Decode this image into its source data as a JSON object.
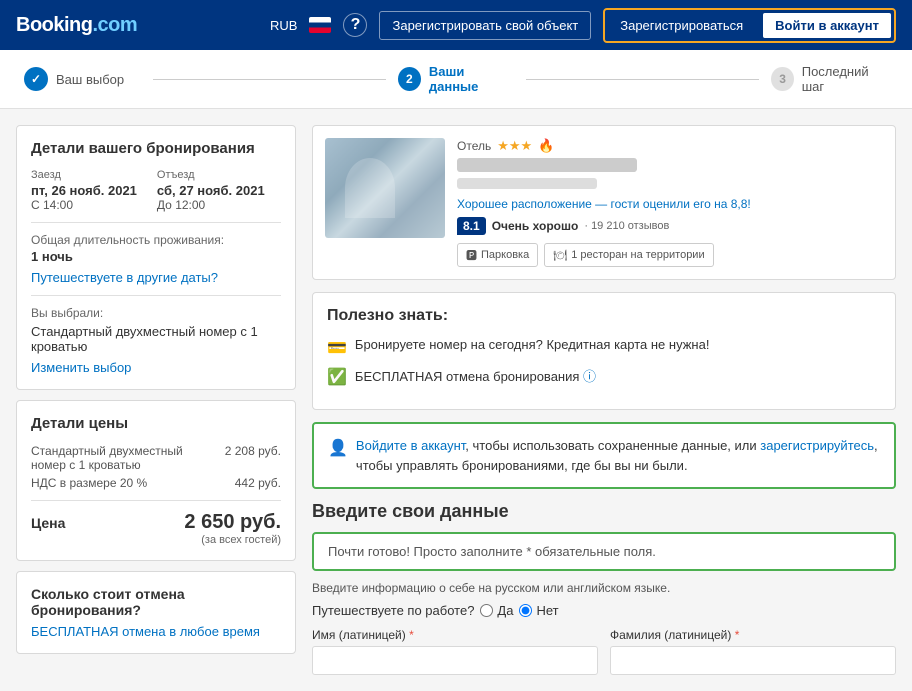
{
  "header": {
    "logo": "Booking.com",
    "logo_dot": ".com",
    "currency": "RUB",
    "help_label": "?",
    "register_property_label": "Зарегистрировать свой объект",
    "signin_label": "Зарегистрироваться",
    "login_label": "Войти в аккаунт"
  },
  "progress": {
    "step1": {
      "number": "✓",
      "label": "Ваш выбор",
      "state": "done"
    },
    "step2": {
      "number": "2",
      "label": "Ваши данные",
      "state": "active"
    },
    "step3": {
      "number": "3",
      "label": "Последний шаг",
      "state": "inactive"
    }
  },
  "booking_details": {
    "title": "Детали вашего бронирования",
    "checkin_label": "Заезд",
    "checkin_date": "пт, 26 нояб. 2021",
    "checkin_time": "С 14:00",
    "checkout_label": "Отъезд",
    "checkout_date": "сб, 27 нояб. 2021",
    "checkout_time": "До 12:00",
    "duration_label": "Общая длительность проживания:",
    "duration_value": "1 ночь",
    "change_dates_link": "Путешествуете в другие даты?",
    "room_section_label": "Вы выбрали:",
    "room_name": "Стандартный двухместный номер с 1 кроватью",
    "change_room_link": "Изменить выбор"
  },
  "price_details": {
    "title": "Детали цены",
    "room_price_label": "Стандартный двухместный номер с 1 кроватью",
    "room_price_value": "2 208 руб.",
    "vat_label": "НДС в размере 20 %",
    "vat_value": "442 руб.",
    "total_label": "Цена",
    "total_value": "2 650 руб.",
    "guests_note": "(за всех гостей)"
  },
  "cancellation": {
    "title": "Сколько стоит отмена бронирования?",
    "link": "БЕСПЛАТНАЯ отмена в любое время"
  },
  "hotel": {
    "type": "Отель",
    "stars": "★★★",
    "location_good": "Хорошее расположение — гости оценили его на 8,8!",
    "rating_value": "8.1",
    "rating_label": "Очень хорошо",
    "review_count": "19 210 отзывов",
    "amenities": [
      {
        "icon": "P",
        "label": "Парковка"
      },
      {
        "icon": "🍽",
        "label": "1 ресторан на территории"
      }
    ]
  },
  "useful_info": {
    "title": "Полезно знать:",
    "items": [
      {
        "icon": "card",
        "text": "Бронируете номер на сегодня? Кредитная карта не нужна!"
      },
      {
        "icon": "check",
        "text": "БЕСПЛАТНАЯ отмена бронирования"
      }
    ]
  },
  "login_promo": {
    "icon": "👤",
    "text_before": "Войдите в аккаунт",
    "text_middle": ", чтобы использовать сохраненные данные, или ",
    "text_register": "зарегистрируйтесь",
    "text_after": ", чтобы управлять бронированиями, где бы вы ни были."
  },
  "form": {
    "section_title": "Введите свои данные",
    "hint_text": "Почти готово! Просто заполните * обязательные поля.",
    "instruction": "Введите информацию о себе на русском или английском языке.",
    "work_travel_question": "Путешествуете по работе?",
    "radio_yes_label": "Да",
    "radio_no_label": "Нет",
    "first_name_label": "Имя (латиницей)",
    "last_name_label": "Фамилия (латиницей)",
    "required_mark": "*"
  }
}
